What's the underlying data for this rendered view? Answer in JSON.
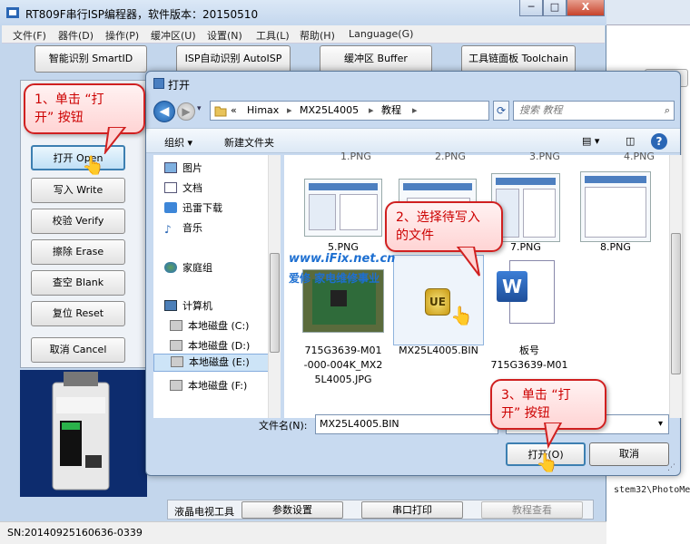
{
  "app": {
    "title": "RT809F串行ISP编程器，软件版本：20150510",
    "window_controls": {
      "minimize": "─",
      "maximize": "□",
      "close": "X"
    },
    "menu": [
      "文件(F)",
      "器件(D)",
      "操作(P)",
      "缓冲区(U)",
      "设置(N)",
      "工具(L)",
      "帮助(H)",
      "Language(G)"
    ],
    "toolbar": [
      "智能识别 SmartID",
      "ISP自动识别 AutoISP",
      "缓冲区 Buffer",
      "工具链面板 Toolchain"
    ],
    "side_buttons": [
      "打开 Open",
      "写入 Write",
      "校验 Verify",
      "擦除 Erase",
      "查空 Blank",
      "复位 Reset",
      "取消 Cancel"
    ],
    "bottom_buttons": [
      "液晶电视工具",
      "参数设置",
      "串口打印",
      "教程查看"
    ],
    "status": "SN:20140925160636-0339"
  },
  "background": {
    "close_label": "X",
    "console_text": "stem32\\PhotoMet"
  },
  "dialog": {
    "title": "打开",
    "breadcrumb": [
      "«",
      "Himax",
      "MX25L4005",
      "教程"
    ],
    "search_placeholder": "搜索 教程",
    "commands": {
      "organize": "组织 ▾",
      "new_folder": "新建文件夹"
    },
    "nav": {
      "items": [
        "图片",
        "文档",
        "迅雷下载",
        "音乐"
      ],
      "homegroup": "家庭组",
      "computer": "计算机",
      "drives": [
        "本地磁盘 (C:)",
        "本地磁盘 (D:)",
        "本地磁盘 (E:)",
        "本地磁盘 (F:)"
      ]
    },
    "files_top_row": [
      "1.PNG",
      "2.PNG",
      "3.PNG",
      "4.PNG"
    ],
    "files": [
      {
        "name": "5.PNG"
      },
      {
        "name": "6.PNG"
      },
      {
        "name": "7.PNG"
      },
      {
        "name": "8.PNG"
      },
      {
        "name_lines": [
          "715G3639-M01",
          "-000-004K_MX2",
          "5L4005.JPG"
        ]
      },
      {
        "name_lines": [
          "MX25L4005.BIN"
        ]
      },
      {
        "name_lines": [
          "板号",
          "715G3639-M01"
        ]
      }
    ],
    "filename_label": "文件名(N):",
    "filename_value": "MX25L4005.BIN",
    "open_button": "打开(O)",
    "cancel_button": "取消"
  },
  "annotations": {
    "step1": [
      "1、单击 “打",
      "开” 按钮"
    ],
    "step2": [
      "2、选择待写入",
      "的文件"
    ],
    "step3": [
      "3、单击 “打",
      "开” 按钮"
    ],
    "watermark": "www.iFix.net.cn",
    "watermark2": "爱修  家电维修事业"
  },
  "colors": {
    "accent": "#3c7fb1",
    "callout_border": "#d02020",
    "callout_text": "#cc0000"
  }
}
